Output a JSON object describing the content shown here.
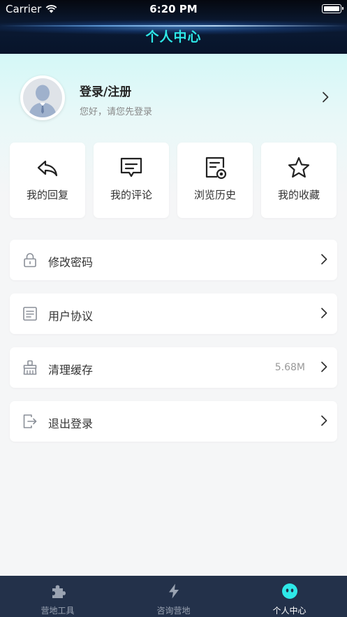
{
  "status_bar": {
    "carrier": "Carrier",
    "time": "6:20 PM"
  },
  "nav": {
    "title": "个人中心"
  },
  "profile": {
    "name": "登录/注册",
    "subtitle": "您好，请您先登录"
  },
  "quick_actions": [
    {
      "label": "我的回复",
      "icon": "reply-icon"
    },
    {
      "label": "我的评论",
      "icon": "comment-icon"
    },
    {
      "label": "浏览历史",
      "icon": "history-icon"
    },
    {
      "label": "我的收藏",
      "icon": "star-icon"
    }
  ],
  "menu": [
    {
      "label": "修改密码",
      "value": "",
      "icon": "lock-icon"
    },
    {
      "label": "用户协议",
      "value": "",
      "icon": "document-icon"
    },
    {
      "label": "清理缓存",
      "value": "5.68M",
      "icon": "broom-icon"
    },
    {
      "label": "退出登录",
      "value": "",
      "icon": "logout-icon"
    }
  ],
  "tabbar": {
    "tabs": [
      {
        "label": "营地工具",
        "icon": "puzzle-icon",
        "active": false
      },
      {
        "label": "咨询营地",
        "icon": "lightning-icon",
        "active": false
      },
      {
        "label": "个人中心",
        "icon": "face-icon",
        "active": true
      }
    ]
  },
  "colors": {
    "nav_title": "#2ee8e8",
    "tabbar_bg": "#23314a",
    "active_tab_icon": "#2ee8e8",
    "card_bg": "#ffffff"
  }
}
